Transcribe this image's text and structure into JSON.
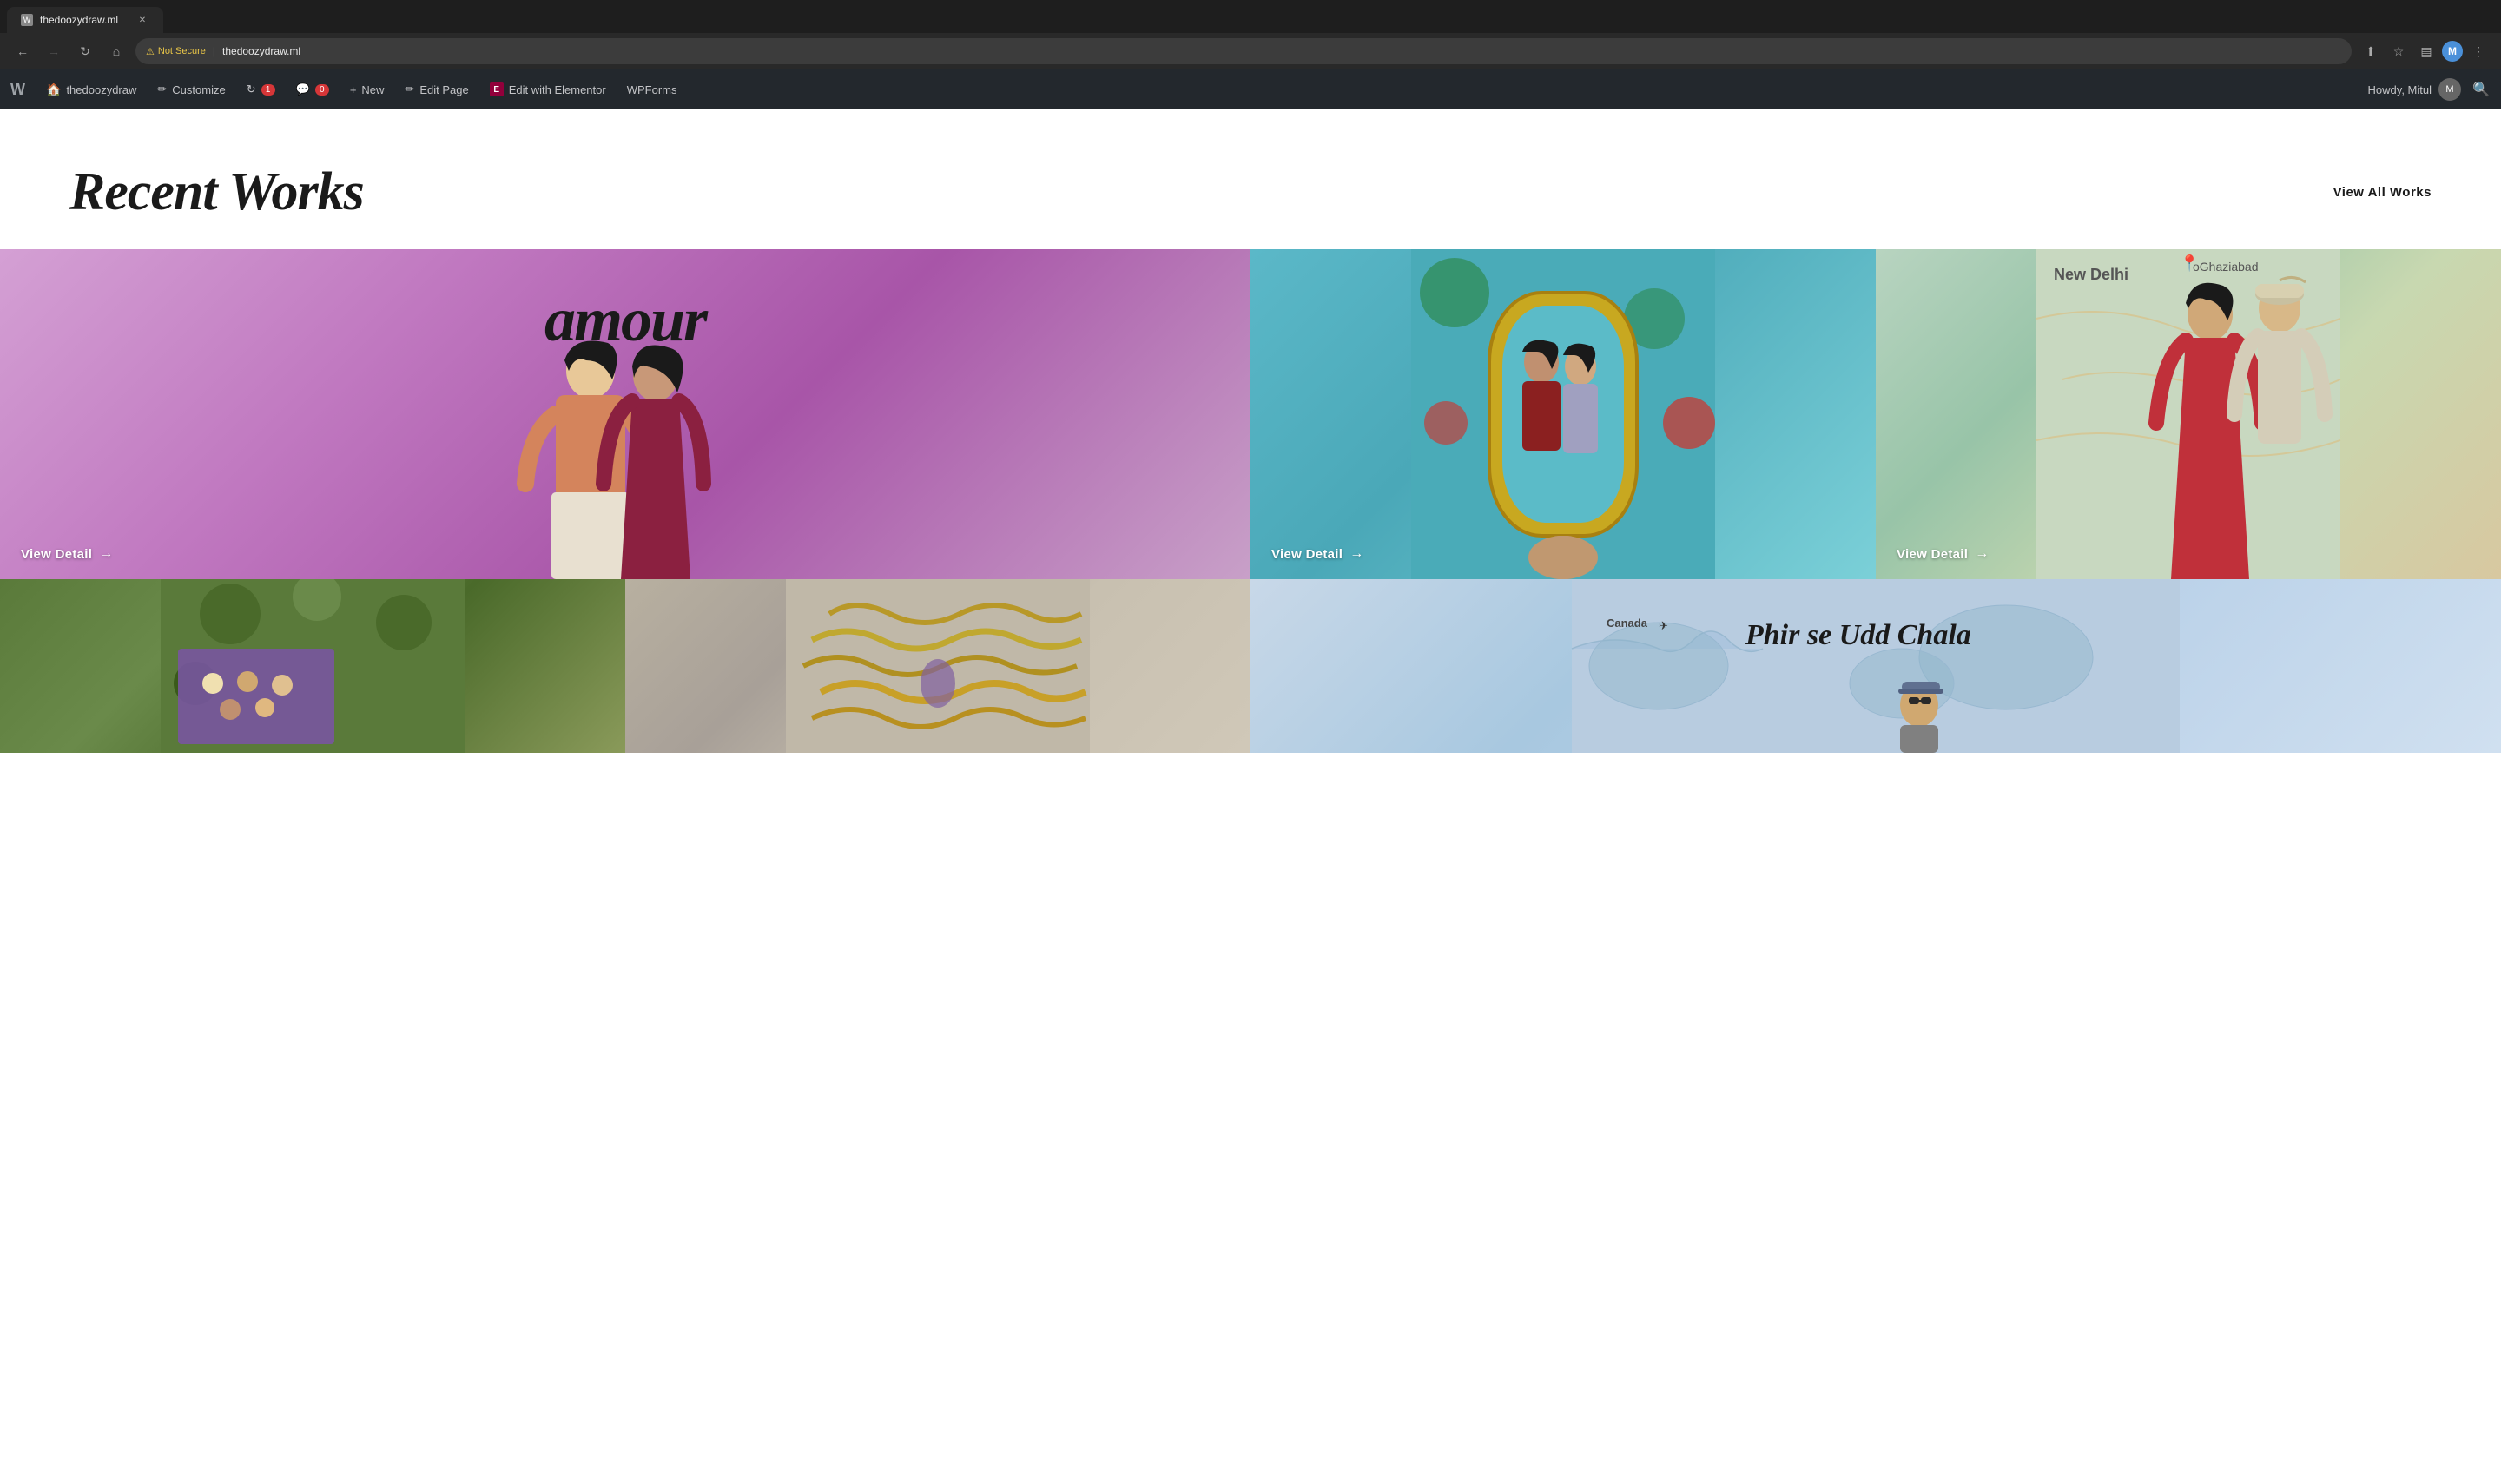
{
  "browser": {
    "tab_title": "thedoozydraw.ml",
    "tab_favicon": "W",
    "not_secure_label": "Not Secure",
    "url": "thedoozydraw.ml",
    "nav": {
      "back_disabled": false,
      "forward_disabled": true
    },
    "actions": {
      "share": "⬆",
      "bookmark": "☆",
      "sidebar": "▤",
      "profile_initial": "M",
      "more": "⋮"
    }
  },
  "wp_admin_bar": {
    "items": [
      {
        "id": "wp-logo",
        "label": "W",
        "type": "logo"
      },
      {
        "id": "site-name",
        "label": "thedoozydraw",
        "icon": "site"
      },
      {
        "id": "customize",
        "label": "Customize",
        "icon": "pencil"
      },
      {
        "id": "updates",
        "label": "1",
        "badge": true,
        "icon": "update"
      },
      {
        "id": "comments",
        "label": "0",
        "badge": true,
        "icon": "comment"
      },
      {
        "id": "new",
        "label": "New",
        "icon": "plus"
      },
      {
        "id": "edit-page",
        "label": "Edit Page",
        "icon": "edit"
      },
      {
        "id": "elementor",
        "label": "Edit with Elementor",
        "icon": "elementor"
      },
      {
        "id": "wpforms",
        "label": "WPForms"
      }
    ],
    "howdy": "Howdy, Mitul",
    "avatar_initial": "M"
  },
  "page": {
    "recent_works_title": "Recent Works",
    "view_all_label": "View All Works",
    "gallery": {
      "row1": [
        {
          "id": "amour",
          "type": "amour",
          "view_detail": "View Detail",
          "arrow": "→"
        },
        {
          "id": "portrait",
          "type": "portrait",
          "view_detail": "View Detail",
          "arrow": "→"
        },
        {
          "id": "wedding",
          "type": "wedding",
          "view_detail": "View Detail",
          "arrow": "→"
        }
      ],
      "row2": [
        {
          "id": "fabric",
          "type": "fabric"
        },
        {
          "id": "chains",
          "type": "chains"
        },
        {
          "id": "map-travel",
          "type": "map",
          "map_title": "Phir se Udd Chala"
        }
      ]
    }
  },
  "colors": {
    "wp_bar_bg": "#23282d",
    "wp_bar_text": "#c3c4c7",
    "accent_red": "#d63638",
    "amour_bg_start": "#d4a0d4",
    "amour_bg_end": "#9850a0",
    "portrait_bg": "#5bb8c8",
    "wedding_bg": "#b8d4c0"
  }
}
